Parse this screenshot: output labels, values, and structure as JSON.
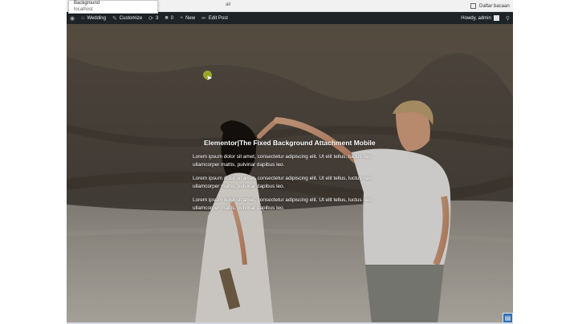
{
  "browser": {
    "url_popup": {
      "title": "Background",
      "subtitle": "localhost"
    },
    "tab_fragment": "ail",
    "right_tab": {
      "label": "Daftar bacaan"
    }
  },
  "admin_bar": {
    "site_name": "Wedding",
    "customize": "Customize",
    "updates_count": "3",
    "comments_count": "0",
    "new_label": "New",
    "edit_post": "Edit Post",
    "greeting": "Howdy, admin"
  },
  "hero": {
    "title": "Elementor|The Fixed Background Attachment Mobile",
    "paragraphs": [
      "Lorem ipsum dolor sit amet, consectetur adipiscing elit. Ut elit tellus, luctus nec ullamcorper mattis, pulvinar dapibus leo.",
      "Lorem ipsum dolor sit amet, consectetur adipiscing elit. Ut elit tellus, luctus nec ullamcorper mattis, pulvinar dapibus leo.",
      "Lorem ipsum dolor sit amet, consectetur adipiscing elit. Ut elit tellus, luctus nec ullamcorper mattis, pulvinar dapibus leo."
    ]
  },
  "colors": {
    "admin_bar_bg": "#1d2327",
    "admin_bar_text": "#f0f0f1",
    "hero_text": "#ffffff"
  },
  "icons": [
    "wordpress-logo-icon",
    "home-icon",
    "customize-brush-icon",
    "updates-icon",
    "comments-icon",
    "plus-icon",
    "pencil-icon",
    "avatar",
    "search-icon",
    "page-icon",
    "mouse-cursor-icon"
  ]
}
